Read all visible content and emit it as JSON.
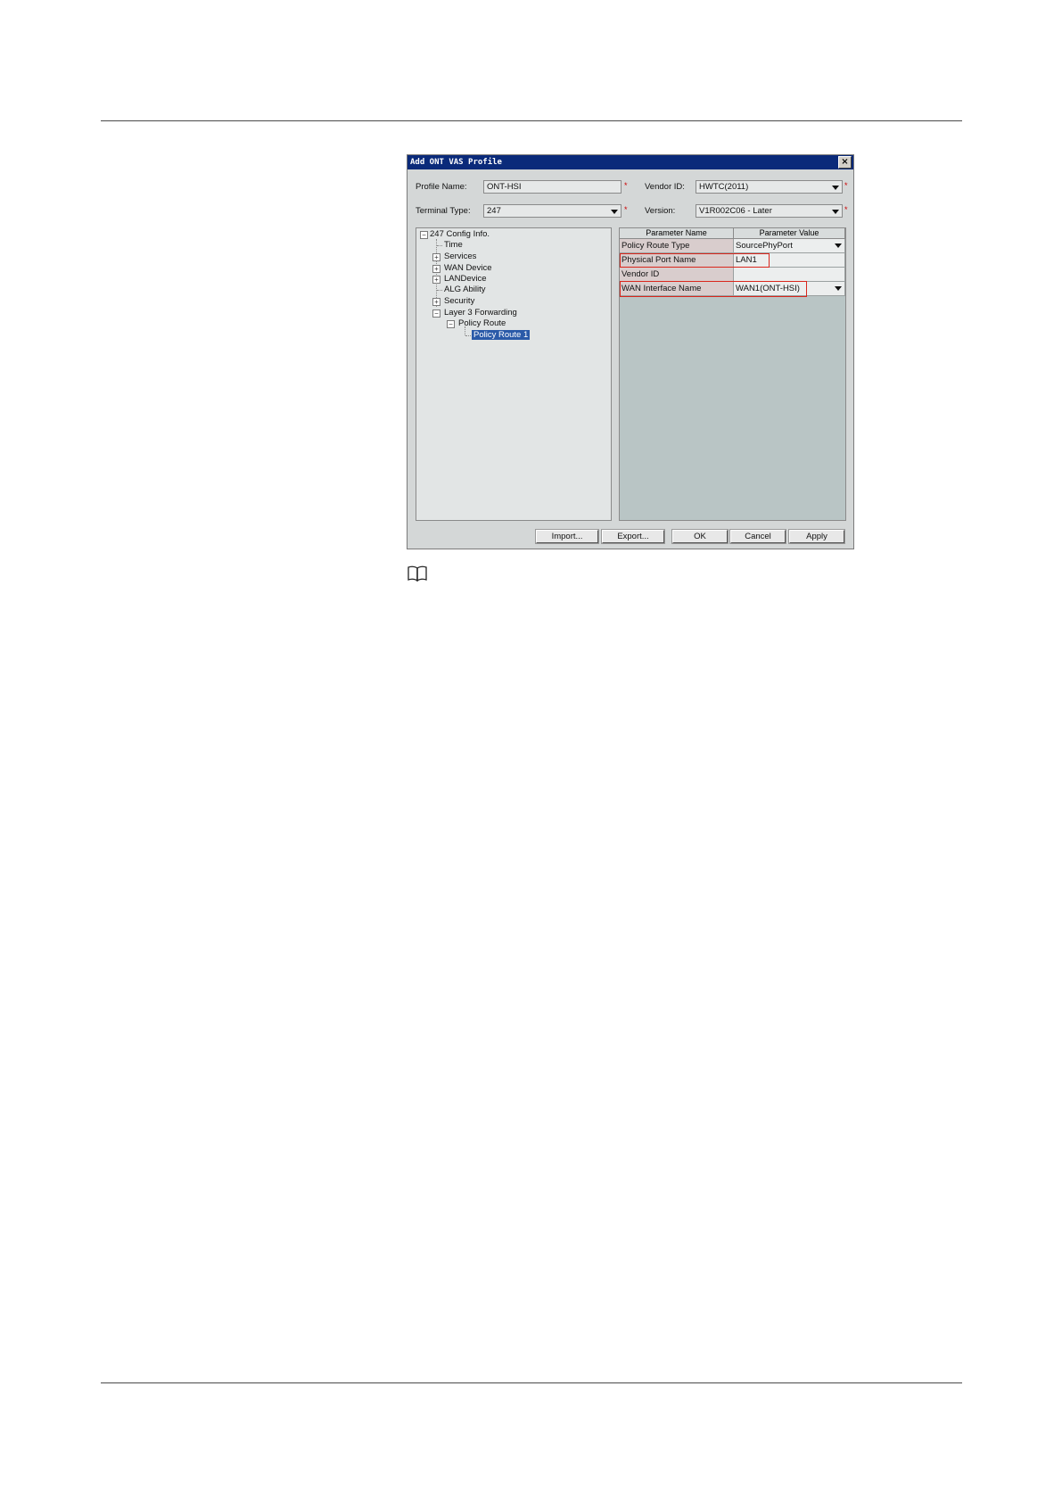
{
  "dialog": {
    "title": "Add ONT VAS Profile",
    "close_glyph": "×"
  },
  "form": {
    "profile_name_label": "Profile Name:",
    "profile_name_value": "ONT-HSI",
    "vendor_id_label": "Vendor ID:",
    "vendor_id_value": "HWTC(2011)",
    "terminal_type_label": "Terminal Type:",
    "terminal_type_value": "247",
    "version_label": "Version:",
    "version_value": "V1R002C06 - Later",
    "required_mark": "*"
  },
  "tree": {
    "root": "247 Config Info.",
    "items": [
      "Time",
      "Services",
      "WAN Device",
      "LANDevice",
      "ALG Ability",
      "Security",
      "Layer 3 Forwarding",
      "Policy Route",
      "Policy Route 1"
    ]
  },
  "grid": {
    "headers": [
      "Parameter Name",
      "Parameter Value"
    ],
    "rows": [
      {
        "name": "Policy Route Type",
        "value": "SourcePhyPort"
      },
      {
        "name": "Physical Port Name",
        "value": "LAN1"
      },
      {
        "name": "Vendor ID",
        "value": ""
      },
      {
        "name": "WAN Interface Name",
        "value": "WAN1(ONT-HSI)"
      }
    ]
  },
  "buttons": {
    "import": "Import...",
    "export": "Export...",
    "ok": "OK",
    "cancel": "Cancel",
    "apply": "Apply"
  },
  "colors": {
    "titlebar": "#0a2a7a",
    "highlight": "#d9261c",
    "selected": "#2a5aa8"
  },
  "icons": {
    "note": "book-icon"
  }
}
